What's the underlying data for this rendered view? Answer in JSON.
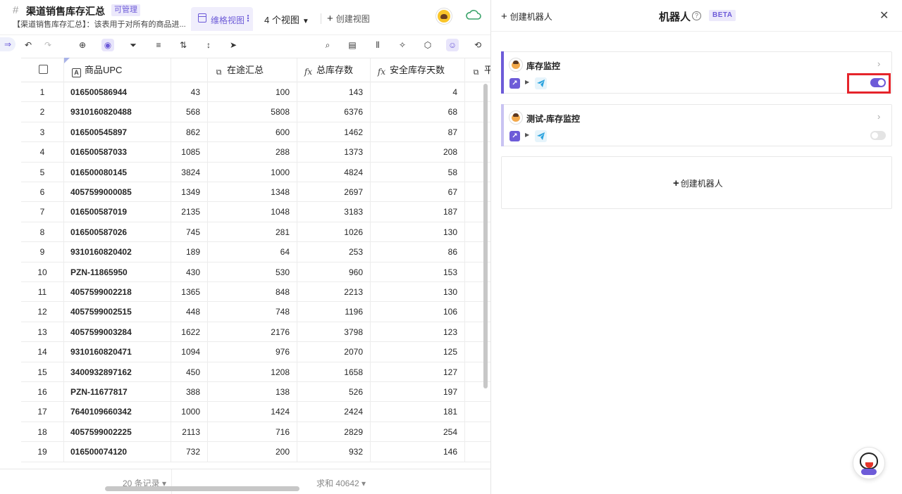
{
  "header": {
    "hash_icon": "hash-icon",
    "title": "渠道销售库存汇总",
    "manage_badge": "可管理",
    "description": "【渠道销售库存汇总】：该表用于对所有的商品进...",
    "active_view": "维格视图",
    "view_count": "4 个视图",
    "create_view": "创建视图"
  },
  "table": {
    "columns": [
      {
        "label": "",
        "icon": "checkbox"
      },
      {
        "label": "商品UPC",
        "icon": "text-field-icon"
      },
      {
        "label": "",
        "icon": ""
      },
      {
        "label": "在途汇总",
        "icon": "lookup-icon"
      },
      {
        "label": "总库存数",
        "icon": "formula-icon"
      },
      {
        "label": "安全库存天数",
        "icon": "formula-icon"
      },
      {
        "label": "平",
        "icon": "lookup-icon"
      }
    ],
    "rows": [
      [
        "1",
        "016500586944",
        "43",
        "100",
        "143",
        "4"
      ],
      [
        "2",
        "9310160820488",
        "568",
        "5808",
        "6376",
        "68"
      ],
      [
        "3",
        "016500545897",
        "862",
        "600",
        "1462",
        "87"
      ],
      [
        "4",
        "016500587033",
        "1085",
        "288",
        "1373",
        "208"
      ],
      [
        "5",
        "016500080145",
        "3824",
        "1000",
        "4824",
        "58"
      ],
      [
        "6",
        "4057599000085",
        "1349",
        "1348",
        "2697",
        "67"
      ],
      [
        "7",
        "016500587019",
        "2135",
        "1048",
        "3183",
        "187"
      ],
      [
        "8",
        "016500587026",
        "745",
        "281",
        "1026",
        "130"
      ],
      [
        "9",
        "9310160820402",
        "189",
        "64",
        "253",
        "86"
      ],
      [
        "10",
        "PZN-11865950",
        "430",
        "530",
        "960",
        "153"
      ],
      [
        "11",
        "4057599002218",
        "1365",
        "848",
        "2213",
        "130"
      ],
      [
        "12",
        "4057599002515",
        "448",
        "748",
        "1196",
        "106"
      ],
      [
        "13",
        "4057599003284",
        "1622",
        "2176",
        "3798",
        "123"
      ],
      [
        "14",
        "9310160820471",
        "1094",
        "976",
        "2070",
        "125"
      ],
      [
        "15",
        "3400932897162",
        "450",
        "1208",
        "1658",
        "127"
      ],
      [
        "16",
        "PZN-11677817",
        "388",
        "138",
        "526",
        "197"
      ],
      [
        "17",
        "7640109660342",
        "1000",
        "1424",
        "2424",
        "181"
      ],
      [
        "18",
        "4057599002225",
        "2113",
        "716",
        "2829",
        "254"
      ],
      [
        "19",
        "016500074120",
        "732",
        "200",
        "932",
        "146"
      ]
    ],
    "record_count": "20 条记录",
    "sum": "求和 40642"
  },
  "robot_panel": {
    "create_robot": "创建机器人",
    "title": "机器人",
    "beta": "BETA",
    "robots": [
      {
        "name": "库存监控",
        "enabled": true,
        "accent": "#6d5bd8"
      },
      {
        "name": "测试-库存监控",
        "enabled": false,
        "accent": "#c9c3f2"
      }
    ],
    "create_robot_box": "创建机器人"
  },
  "colors": {
    "accent": "#6d5bd8",
    "highlight": "#e5242b"
  }
}
